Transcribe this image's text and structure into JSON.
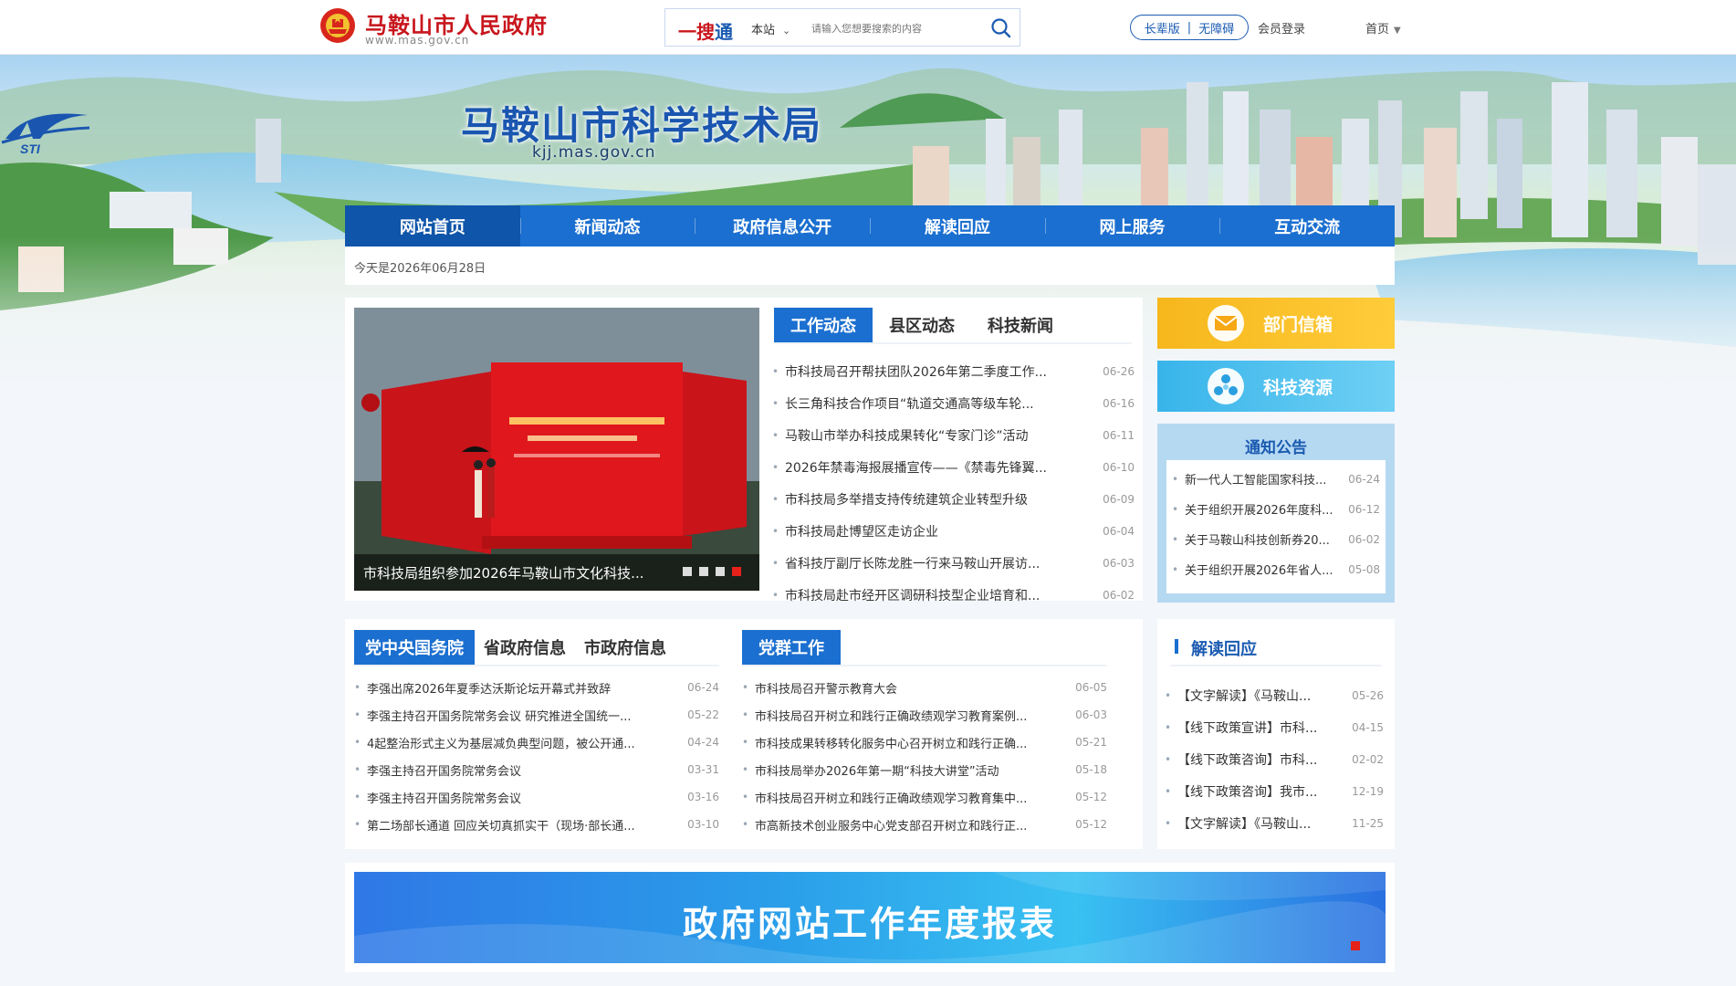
{
  "topbar": {
    "gov_name": "马鞍山市人民政府",
    "gov_url": "www.mas.gov.cn",
    "search_brand_a": "一搜",
    "search_brand_b": "通",
    "search_scope": "本站",
    "search_placeholder": "请输入您想要搜索的内容",
    "mode_elder": "长辈版",
    "mode_accessible": "无障碍",
    "member_login": "会员登录",
    "home": "首页"
  },
  "banner": {
    "logo_text": "STI",
    "bureau_name": "马鞍山市科学技术局",
    "bureau_url": "kjj.mas.gov.cn"
  },
  "nav": [
    "网站首页",
    "新闻动态",
    "政府信息公开",
    "解读回应",
    "网上服务",
    "互动交流"
  ],
  "date_text": "今天是2026年06月28日",
  "slider": {
    "caption": "市科技局组织参加2026年马鞍山市文化科技..."
  },
  "work_tabs": [
    "工作动态",
    "县区动态",
    "科技新闻"
  ],
  "work_news": [
    {
      "title": "市科技局召开帮扶团队2026年第二季度工作...",
      "date": "06-26"
    },
    {
      "title": "长三角科技合作项目“轨道交通高等级车轮...",
      "date": "06-16"
    },
    {
      "title": "马鞍山市举办科技成果转化“专家门诊”活动",
      "date": "06-11"
    },
    {
      "title": "2026年禁毒海报展播宣传——《禁毒先锋翼...",
      "date": "06-10"
    },
    {
      "title": "市科技局多举措支持传统建筑企业转型升级",
      "date": "06-09"
    },
    {
      "title": "市科技局赴博望区走访企业",
      "date": "06-04"
    },
    {
      "title": "省科技厅副厅长陈龙胜一行来马鞍山开展访...",
      "date": "06-03"
    },
    {
      "title": "市科技局赴市经开区调研科技型企业培育和...",
      "date": "06-02"
    }
  ],
  "side": {
    "mailbox": "部门信箱",
    "resource": "科技资源",
    "notice_title": "通知公告",
    "notices": [
      {
        "title": "新一代人工智能国家科技...",
        "date": "06-24"
      },
      {
        "title": "关于组织开展2026年度科...",
        "date": "06-12"
      },
      {
        "title": "关于马鞍山科技创新券20...",
        "date": "06-02"
      },
      {
        "title": "关于组织开展2026年省人...",
        "date": "05-08"
      }
    ]
  },
  "gov_tabs": [
    "党中央国务院",
    "省政府信息",
    "市政府信息"
  ],
  "gov_news": [
    {
      "title": "李强出席2026年夏季达沃斯论坛开幕式并致辞",
      "date": "06-24"
    },
    {
      "title": "李强主持召开国务院常务会议 研究推进全国统一...",
      "date": "05-22"
    },
    {
      "title": "4起整治形式主义为基层减负典型问题，被公开通...",
      "date": "04-24"
    },
    {
      "title": "李强主持召开国务院常务会议",
      "date": "03-31"
    },
    {
      "title": "李强主持召开国务院常务会议",
      "date": "03-16"
    },
    {
      "title": "第二场部长通道 回应关切真抓实干（现场·部长通...",
      "date": "03-10"
    }
  ],
  "party_tabs": [
    "党群工作"
  ],
  "party_news": [
    {
      "title": "市科技局召开警示教育大会",
      "date": "06-05"
    },
    {
      "title": "市科技局召开树立和践行正确政绩观学习教育案例...",
      "date": "06-03"
    },
    {
      "title": "市科技成果转移转化服务中心召开树立和践行正确...",
      "date": "05-21"
    },
    {
      "title": "市科技局举办2026年第一期“科技大讲堂”活动",
      "date": "05-18"
    },
    {
      "title": "市科技局召开树立和践行正确政绩观学习教育集中...",
      "date": "05-12"
    },
    {
      "title": "市高新技术创业服务中心党支部召开树立和践行正...",
      "date": "05-12"
    }
  ],
  "jiedu": {
    "title": "解读回应",
    "items": [
      {
        "title": "【文字解读】《马鞍山...",
        "date": "05-26"
      },
      {
        "title": "【线下政策宣讲】市科...",
        "date": "04-15"
      },
      {
        "title": "【线下政策咨询】市科...",
        "date": "02-02"
      },
      {
        "title": "【线下政策咨询】我市...",
        "date": "12-19"
      },
      {
        "title": "【文字解读】《马鞍山...",
        "date": "11-25"
      }
    ]
  },
  "report_banner": "政府网站工作年度报表",
  "colors": {
    "brand_blue": "#1b6fd0",
    "gov_red": "#c8161d",
    "mailbox_yellow": "#f6b71c",
    "resource_cyan": "#38b4ea"
  }
}
